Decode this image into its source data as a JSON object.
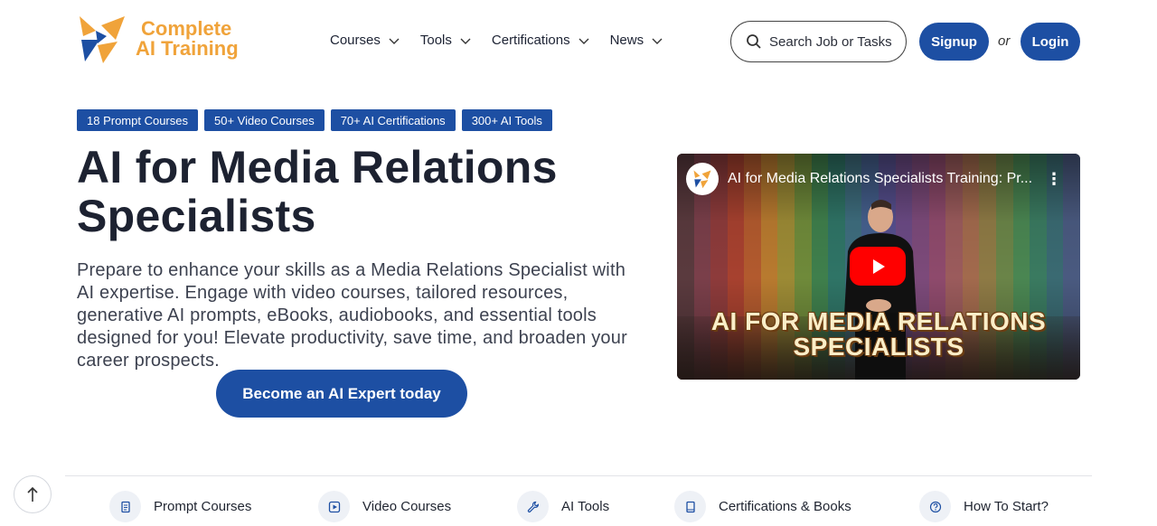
{
  "header": {
    "logo": {
      "line1": "Complete",
      "line2": "AI Training"
    },
    "nav": [
      {
        "label": "Courses"
      },
      {
        "label": "Tools"
      },
      {
        "label": "Certifications"
      },
      {
        "label": "News"
      }
    ],
    "search_placeholder": "Search Job or Tasks",
    "signup_label": "Signup",
    "or_label": "or",
    "login_label": "Login"
  },
  "badges": [
    "18 Prompt Courses",
    "50+ Video Courses",
    "70+ AI Certifications",
    "300+ AI Tools"
  ],
  "hero": {
    "title": "AI for Media Relations Specialists",
    "description": "Prepare to enhance your skills as a Media Relations Specialist with AI expertise. Engage with video courses, tailored resources, generative AI prompts, eBooks, audiobooks, and essential tools designed for you! Elevate productivity, save time, and broaden your career prospects.",
    "cta_label": "Become an AI Expert today"
  },
  "video": {
    "title": "AI for Media Relations Specialists Training: Pr...",
    "caption_line1": "AI FOR MEDIA RELATIONS",
    "caption_line2": "SPECIALISTS"
  },
  "bottom_nav": [
    {
      "label": "Prompt Courses",
      "icon": "document-icon"
    },
    {
      "label": "Video Courses",
      "icon": "video-play-icon"
    },
    {
      "label": "AI Tools",
      "icon": "wrench-icon"
    },
    {
      "label": "Certifications & Books",
      "icon": "book-icon"
    },
    {
      "label": "How To Start?",
      "icon": "question-circle-icon"
    }
  ],
  "colors": {
    "brand_blue": "#1d4fa3",
    "logo_orange": "#f0a33a",
    "youtube_red": "#ff0000"
  }
}
